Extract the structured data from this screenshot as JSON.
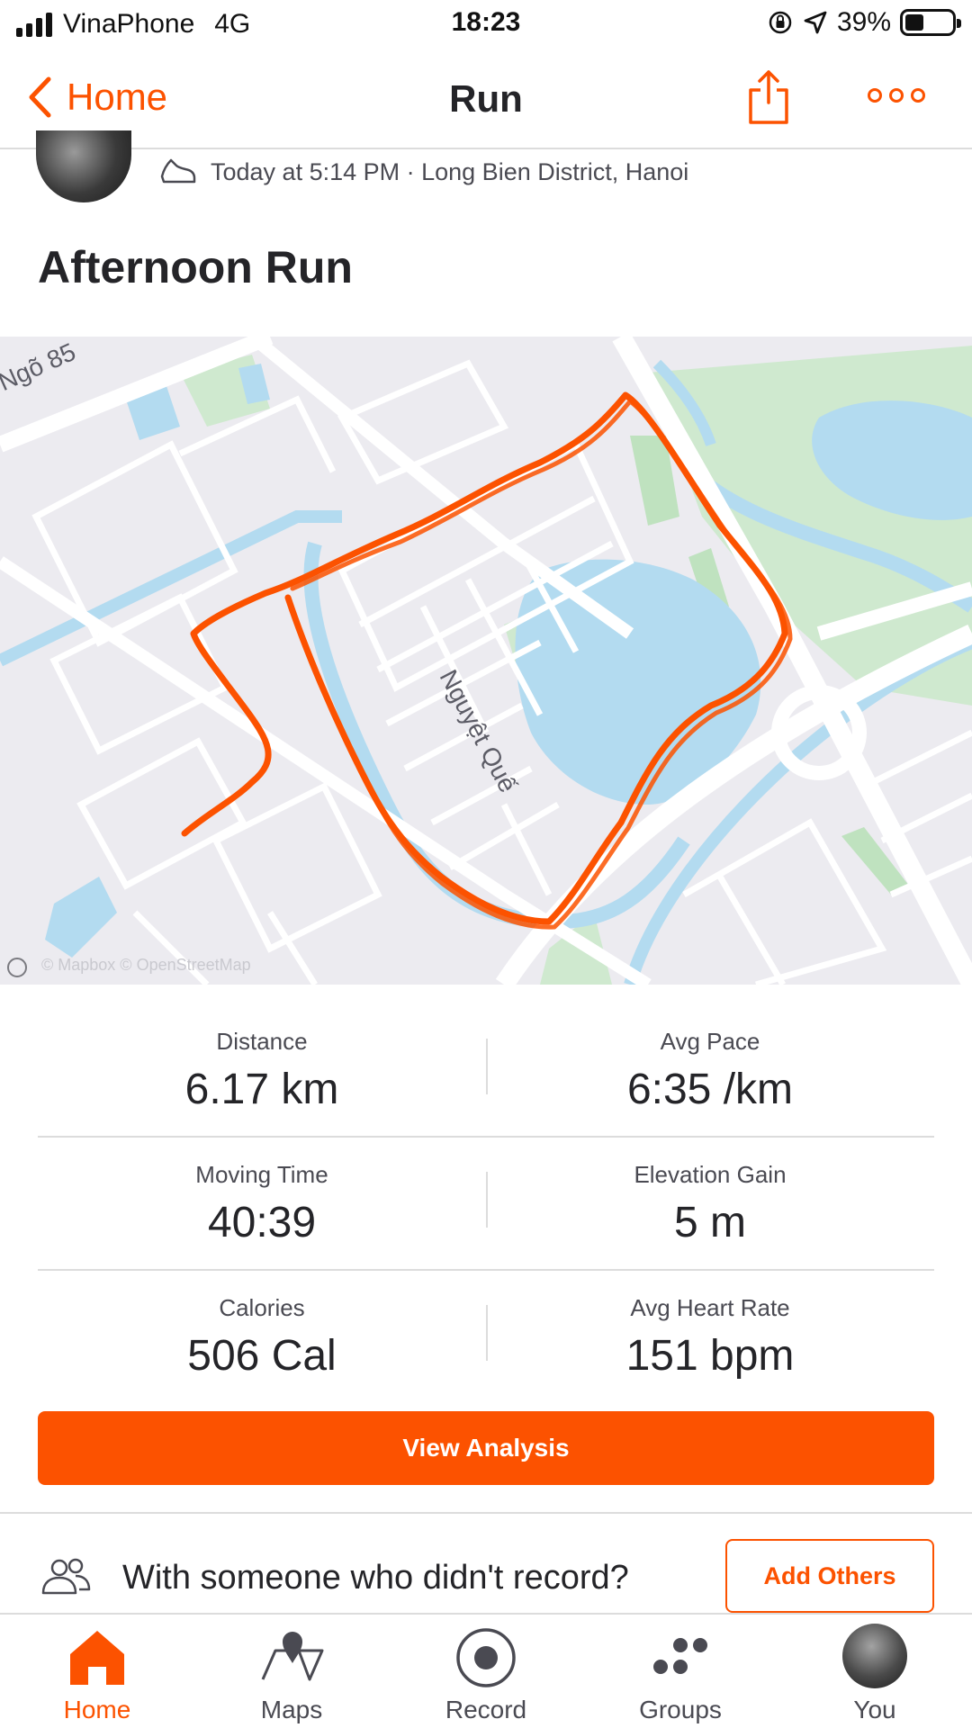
{
  "status_bar": {
    "carrier": "VinaPhone",
    "network": "4G",
    "time": "18:23",
    "battery_percent": "39%",
    "battery_level": 0.39
  },
  "nav": {
    "back_label": "Home",
    "title": "Run",
    "share_icon": "share-icon",
    "more_icon": "more-icon"
  },
  "activity": {
    "meta": "Today at 5:14 PM · Long Bien District, Hanoi",
    "title": "Afternoon Run"
  },
  "map": {
    "street_label_1": "Ngõ 85",
    "street_label_2": "Nguyệt Quế",
    "attribution": "© Mapbox © OpenStreetMap",
    "route_color": "#fc5200",
    "water_color": "#b3dbf0",
    "park_color": "#cfe9cf"
  },
  "stats": [
    {
      "left_label": "Distance",
      "left_value": "6.17 km",
      "right_label": "Avg Pace",
      "right_value": "6:35 /km"
    },
    {
      "left_label": "Moving Time",
      "left_value": "40:39",
      "right_label": "Elevation Gain",
      "right_value": "5 m"
    },
    {
      "left_label": "Calories",
      "left_value": "506 Cal",
      "right_label": "Avg Heart Rate",
      "right_value": "151 bpm"
    }
  ],
  "analysis_button": "View Analysis",
  "others": {
    "prompt": "With someone who didn't record?",
    "button": "Add Others"
  },
  "tabs": [
    {
      "label": "Home",
      "icon": "home-icon",
      "active": true
    },
    {
      "label": "Maps",
      "icon": "maps-icon",
      "active": false
    },
    {
      "label": "Record",
      "icon": "record-icon",
      "active": false
    },
    {
      "label": "Groups",
      "icon": "groups-icon",
      "active": false
    },
    {
      "label": "You",
      "icon": "avatar",
      "active": false
    }
  ],
  "colors": {
    "accent": "#fc5200",
    "text": "#242428",
    "divider": "#dcdcdc"
  }
}
